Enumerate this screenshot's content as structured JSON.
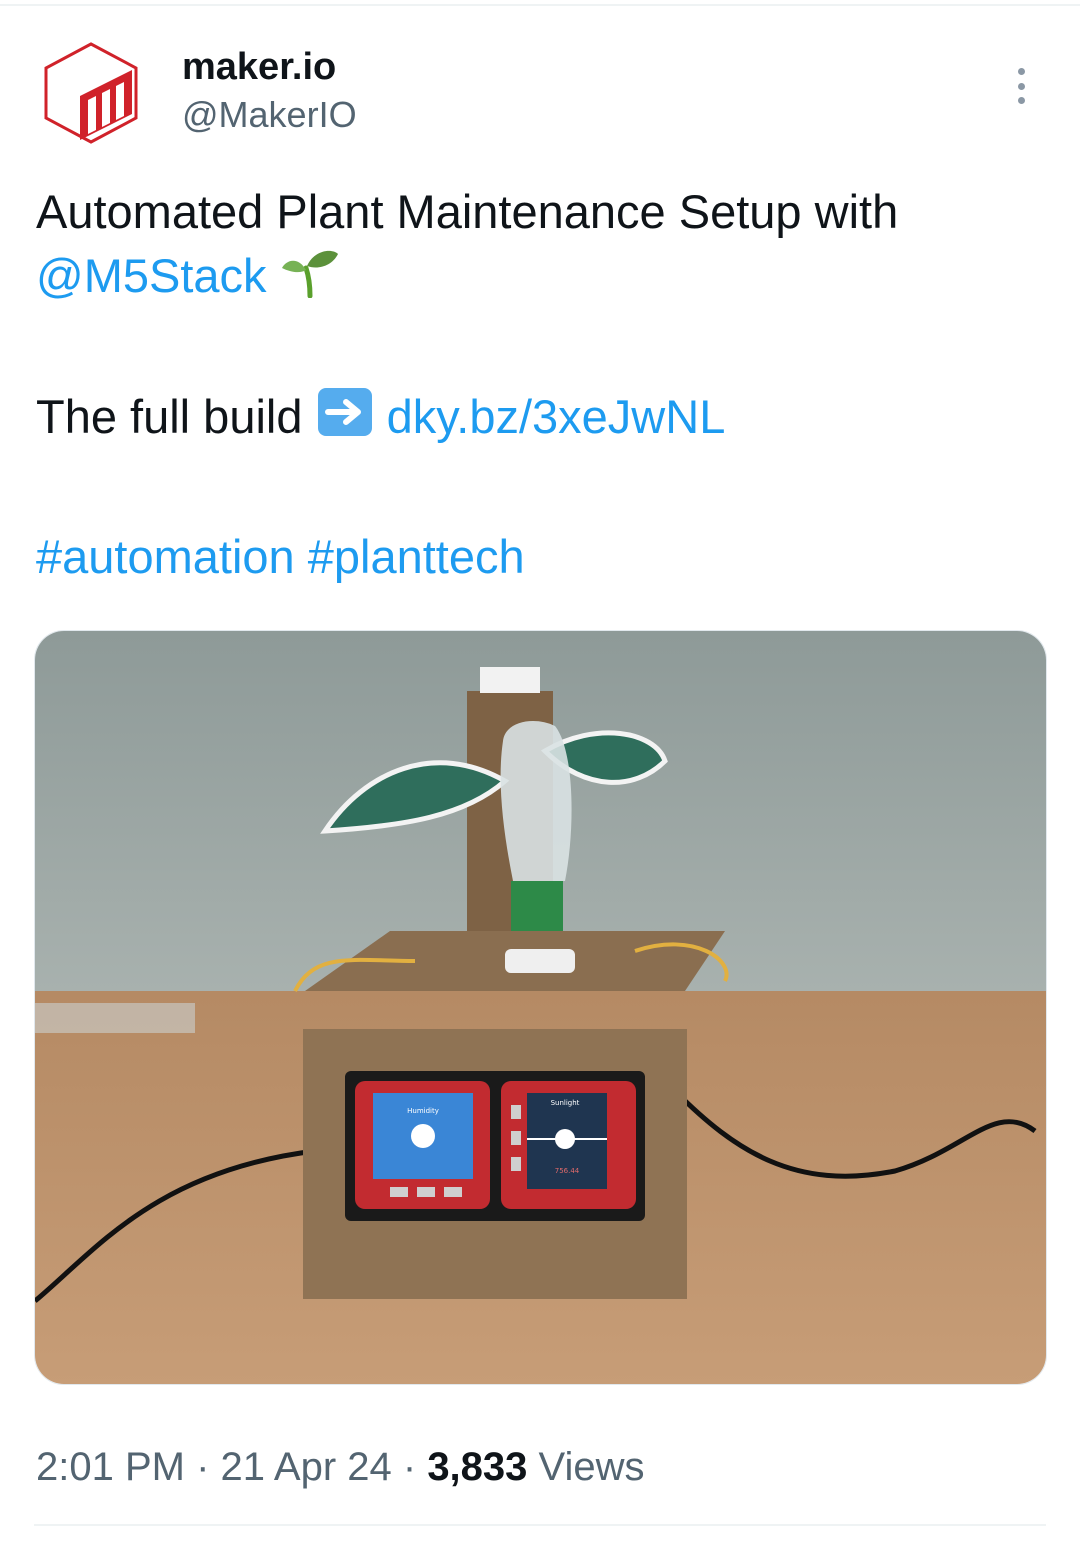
{
  "author": {
    "display_name": "maker.io",
    "handle": "@MakerIO",
    "avatar_icon": "maker-io-logo-icon"
  },
  "more_icon": "more-dots-icon",
  "tweet": {
    "line1": "Automated Plant Maintenance Setup with",
    "mention": "@M5Stack",
    "emoji_seedling": "seedling-emoji",
    "line3_text": "The full build",
    "emoji_arrow": "right-arrow-emoji",
    "link": "dky.bz/3xeJwNL",
    "hashtag1": "#automation",
    "hashtag2": "#planttech"
  },
  "media": {
    "screen_left_label": "Humidity",
    "screen_right_label": "Sunlight",
    "screen_right_value": "756.44"
  },
  "meta": {
    "time": "2:01 PM",
    "sep1": " · ",
    "date": "21 Apr 24",
    "sep2": " · ",
    "views_count": "3,833",
    "views_label": " Views"
  },
  "colors": {
    "link": "#1d9bf0",
    "secondary_text": "#536471",
    "brand_red": "#d0222a"
  }
}
